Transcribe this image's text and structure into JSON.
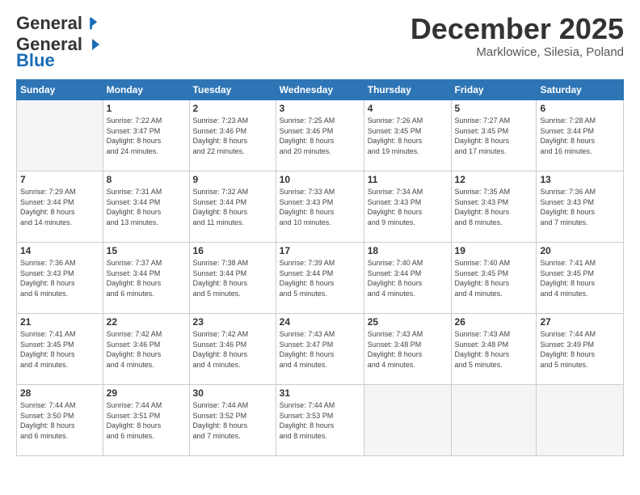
{
  "logo": {
    "general": "General",
    "blue": "Blue"
  },
  "header": {
    "month": "December 2025",
    "location": "Marklowice, Silesia, Poland"
  },
  "weekdays": [
    "Sunday",
    "Monday",
    "Tuesday",
    "Wednesday",
    "Thursday",
    "Friday",
    "Saturday"
  ],
  "weeks": [
    [
      {
        "day": null,
        "info": null
      },
      {
        "day": "1",
        "info": "Sunrise: 7:22 AM\nSunset: 3:47 PM\nDaylight: 8 hours\nand 24 minutes."
      },
      {
        "day": "2",
        "info": "Sunrise: 7:23 AM\nSunset: 3:46 PM\nDaylight: 8 hours\nand 22 minutes."
      },
      {
        "day": "3",
        "info": "Sunrise: 7:25 AM\nSunset: 3:46 PM\nDaylight: 8 hours\nand 20 minutes."
      },
      {
        "day": "4",
        "info": "Sunrise: 7:26 AM\nSunset: 3:45 PM\nDaylight: 8 hours\nand 19 minutes."
      },
      {
        "day": "5",
        "info": "Sunrise: 7:27 AM\nSunset: 3:45 PM\nDaylight: 8 hours\nand 17 minutes."
      },
      {
        "day": "6",
        "info": "Sunrise: 7:28 AM\nSunset: 3:44 PM\nDaylight: 8 hours\nand 16 minutes."
      }
    ],
    [
      {
        "day": "7",
        "info": "Sunrise: 7:29 AM\nSunset: 3:44 PM\nDaylight: 8 hours\nand 14 minutes."
      },
      {
        "day": "8",
        "info": "Sunrise: 7:31 AM\nSunset: 3:44 PM\nDaylight: 8 hours\nand 13 minutes."
      },
      {
        "day": "9",
        "info": "Sunrise: 7:32 AM\nSunset: 3:44 PM\nDaylight: 8 hours\nand 11 minutes."
      },
      {
        "day": "10",
        "info": "Sunrise: 7:33 AM\nSunset: 3:43 PM\nDaylight: 8 hours\nand 10 minutes."
      },
      {
        "day": "11",
        "info": "Sunrise: 7:34 AM\nSunset: 3:43 PM\nDaylight: 8 hours\nand 9 minutes."
      },
      {
        "day": "12",
        "info": "Sunrise: 7:35 AM\nSunset: 3:43 PM\nDaylight: 8 hours\nand 8 minutes."
      },
      {
        "day": "13",
        "info": "Sunrise: 7:36 AM\nSunset: 3:43 PM\nDaylight: 8 hours\nand 7 minutes."
      }
    ],
    [
      {
        "day": "14",
        "info": "Sunrise: 7:36 AM\nSunset: 3:43 PM\nDaylight: 8 hours\nand 6 minutes."
      },
      {
        "day": "15",
        "info": "Sunrise: 7:37 AM\nSunset: 3:44 PM\nDaylight: 8 hours\nand 6 minutes."
      },
      {
        "day": "16",
        "info": "Sunrise: 7:38 AM\nSunset: 3:44 PM\nDaylight: 8 hours\nand 5 minutes."
      },
      {
        "day": "17",
        "info": "Sunrise: 7:39 AM\nSunset: 3:44 PM\nDaylight: 8 hours\nand 5 minutes."
      },
      {
        "day": "18",
        "info": "Sunrise: 7:40 AM\nSunset: 3:44 PM\nDaylight: 8 hours\nand 4 minutes."
      },
      {
        "day": "19",
        "info": "Sunrise: 7:40 AM\nSunset: 3:45 PM\nDaylight: 8 hours\nand 4 minutes."
      },
      {
        "day": "20",
        "info": "Sunrise: 7:41 AM\nSunset: 3:45 PM\nDaylight: 8 hours\nand 4 minutes."
      }
    ],
    [
      {
        "day": "21",
        "info": "Sunrise: 7:41 AM\nSunset: 3:45 PM\nDaylight: 8 hours\nand 4 minutes."
      },
      {
        "day": "22",
        "info": "Sunrise: 7:42 AM\nSunset: 3:46 PM\nDaylight: 8 hours\nand 4 minutes."
      },
      {
        "day": "23",
        "info": "Sunrise: 7:42 AM\nSunset: 3:46 PM\nDaylight: 8 hours\nand 4 minutes."
      },
      {
        "day": "24",
        "info": "Sunrise: 7:43 AM\nSunset: 3:47 PM\nDaylight: 8 hours\nand 4 minutes."
      },
      {
        "day": "25",
        "info": "Sunrise: 7:43 AM\nSunset: 3:48 PM\nDaylight: 8 hours\nand 4 minutes."
      },
      {
        "day": "26",
        "info": "Sunrise: 7:43 AM\nSunset: 3:48 PM\nDaylight: 8 hours\nand 5 minutes."
      },
      {
        "day": "27",
        "info": "Sunrise: 7:44 AM\nSunset: 3:49 PM\nDaylight: 8 hours\nand 5 minutes."
      }
    ],
    [
      {
        "day": "28",
        "info": "Sunrise: 7:44 AM\nSunset: 3:50 PM\nDaylight: 8 hours\nand 6 minutes."
      },
      {
        "day": "29",
        "info": "Sunrise: 7:44 AM\nSunset: 3:51 PM\nDaylight: 8 hours\nand 6 minutes."
      },
      {
        "day": "30",
        "info": "Sunrise: 7:44 AM\nSunset: 3:52 PM\nDaylight: 8 hours\nand 7 minutes."
      },
      {
        "day": "31",
        "info": "Sunrise: 7:44 AM\nSunset: 3:53 PM\nDaylight: 8 hours\nand 8 minutes."
      },
      {
        "day": null,
        "info": null
      },
      {
        "day": null,
        "info": null
      },
      {
        "day": null,
        "info": null
      }
    ]
  ]
}
